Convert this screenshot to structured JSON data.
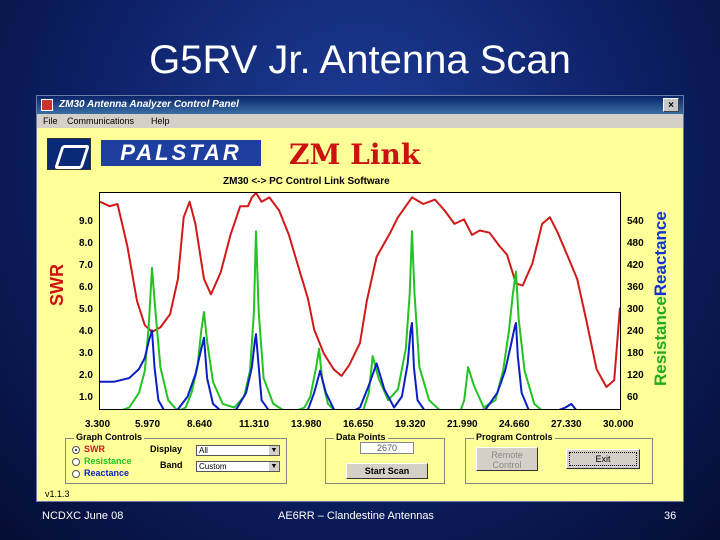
{
  "slide": {
    "title": "G5RV Jr. Antenna Scan",
    "footer_left": "NCDXC June 08",
    "footer_center": "AE6RR – Clandestine Antennas",
    "footer_right": "36"
  },
  "window": {
    "title": "ZM30 Antenna Analyzer Control Panel",
    "close_label": "×",
    "menu": [
      "File",
      "Communications",
      "Help"
    ]
  },
  "brand": {
    "palstar": "PALSTAR",
    "zmlink": "ZM Link",
    "subtitle": "ZM30 <-> PC Control Link Software"
  },
  "chart_data": {
    "type": "line",
    "x_ticks": [
      "3.300",
      "5.970",
      "8.640",
      "11.310",
      "13.980",
      "16.650",
      "19.320",
      "21.990",
      "24.660",
      "27.330",
      "30.000"
    ],
    "xlim": [
      3.3,
      30.0
    ],
    "left_axis_label": "SWR",
    "left_ticks": [
      "1.0",
      "2.0",
      "3.0",
      "4.0",
      "5.0",
      "6.0",
      "7.0",
      "8.0",
      "9.0"
    ],
    "ylim_left": [
      0.6,
      10.4
    ],
    "right_axis_label_1": "Resistance",
    "right_axis_label_2": "Reactance",
    "right_ticks": [
      "60",
      "120",
      "180",
      "240",
      "300",
      "360",
      "420",
      "480",
      "540"
    ],
    "series": [
      {
        "name": "SWR",
        "color": "#d11919",
        "axis": "left",
        "x": [
          3.3,
          3.8,
          4.2,
          4.7,
          5.2,
          5.6,
          5.97,
          6.4,
          6.9,
          7.3,
          7.6,
          7.9,
          8.2,
          8.64,
          9.0,
          9.5,
          10.0,
          10.5,
          10.9,
          11.1,
          11.31,
          11.6,
          12.0,
          12.5,
          13.0,
          13.5,
          13.98,
          14.3,
          14.8,
          15.3,
          15.7,
          16.1,
          16.65,
          17.0,
          17.5,
          18.2,
          18.6,
          19.0,
          19.32,
          19.9,
          20.5,
          21.0,
          21.5,
          21.99,
          22.4,
          22.8,
          23.3,
          23.8,
          24.2,
          24.66,
          25.0,
          25.5,
          26.0,
          26.4,
          26.8,
          27.33,
          27.8,
          28.3,
          28.8,
          29.3,
          29.7,
          30.0
        ],
        "y": [
          10.0,
          9.8,
          9.9,
          8.0,
          5.5,
          4.4,
          4.1,
          4.3,
          4.9,
          6.5,
          9.3,
          10.0,
          9.0,
          6.5,
          5.8,
          6.8,
          8.5,
          9.8,
          9.8,
          10.2,
          10.4,
          10.0,
          10.2,
          9.6,
          8.5,
          7.0,
          5.6,
          4.2,
          3.1,
          2.4,
          2.1,
          2.6,
          3.6,
          5.5,
          7.5,
          8.6,
          9.3,
          9.8,
          10.2,
          9.9,
          10.1,
          9.6,
          9.0,
          9.2,
          8.5,
          8.7,
          8.6,
          8.0,
          7.6,
          6.3,
          6.2,
          7.2,
          9.0,
          9.3,
          8.6,
          7.5,
          6.5,
          4.5,
          2.4,
          1.6,
          1.9,
          5.2
        ]
      },
      {
        "name": "Resistance",
        "color": "#22c322",
        "axis": "right",
        "x": [
          3.3,
          4.0,
          4.8,
          5.3,
          5.6,
          5.8,
          5.97,
          6.15,
          6.4,
          6.8,
          7.3,
          7.7,
          8.0,
          8.3,
          8.5,
          8.64,
          8.8,
          9.1,
          9.6,
          10.2,
          10.7,
          11.0,
          11.2,
          11.31,
          11.45,
          11.7,
          12.2,
          12.8,
          13.3,
          13.8,
          14.1,
          14.4,
          14.55,
          14.7,
          15.0,
          15.5,
          16.0,
          16.5,
          16.8,
          17.1,
          17.3,
          17.6,
          18.1,
          18.6,
          19.0,
          19.2,
          19.32,
          19.45,
          19.7,
          20.2,
          20.8,
          21.4,
          21.8,
          22.0,
          22.2,
          22.5,
          23.0,
          23.6,
          24.0,
          24.3,
          24.5,
          24.66,
          24.8,
          25.1,
          25.6,
          26.2,
          26.8,
          27.3,
          27.7,
          28.2,
          28.8,
          29.4,
          30.0
        ],
        "y": [
          20,
          25,
          40,
          80,
          140,
          260,
          420,
          300,
          150,
          60,
          30,
          40,
          80,
          150,
          250,
          300,
          220,
          110,
          50,
          40,
          70,
          140,
          300,
          520,
          300,
          120,
          50,
          30,
          30,
          40,
          70,
          150,
          200,
          120,
          50,
          25,
          15,
          15,
          30,
          80,
          180,
          120,
          60,
          90,
          200,
          350,
          520,
          350,
          150,
          60,
          30,
          20,
          30,
          60,
          150,
          100,
          40,
          60,
          140,
          250,
          350,
          410,
          280,
          140,
          50,
          20,
          15,
          25,
          15,
          15,
          20,
          15,
          15
        ]
      },
      {
        "name": "Reactance",
        "color": "#0a1fc2",
        "axis": "right",
        "x": [
          3.3,
          4.0,
          4.8,
          5.3,
          5.6,
          5.8,
          5.97,
          6.1,
          6.3,
          6.7,
          7.3,
          7.8,
          8.2,
          8.5,
          8.64,
          8.8,
          9.1,
          9.7,
          10.3,
          10.8,
          11.1,
          11.25,
          11.31,
          11.4,
          11.6,
          12.1,
          12.8,
          13.4,
          13.98,
          14.3,
          14.6,
          14.9,
          15.4,
          16.0,
          16.65,
          17.1,
          17.5,
          17.9,
          18.4,
          18.8,
          19.1,
          19.25,
          19.32,
          19.42,
          19.6,
          20.1,
          20.7,
          21.3,
          21.99,
          22.5,
          23.1,
          23.7,
          24.1,
          24.4,
          24.6,
          24.66,
          24.75,
          24.95,
          25.4,
          26.0,
          26.7,
          27.2,
          27.5,
          27.8,
          28.3,
          28.9,
          29.5,
          30.0
        ],
        "y": [
          110,
          110,
          120,
          145,
          175,
          220,
          250,
          150,
          60,
          20,
          35,
          70,
          130,
          200,
          230,
          120,
          50,
          20,
          35,
          80,
          150,
          220,
          240,
          180,
          60,
          20,
          20,
          20,
          35,
          80,
          140,
          80,
          25,
          20,
          40,
          100,
          160,
          90,
          40,
          70,
          160,
          250,
          270,
          150,
          60,
          20,
          20,
          30,
          30,
          30,
          35,
          80,
          140,
          210,
          260,
          270,
          180,
          80,
          20,
          25,
          30,
          40,
          50,
          30,
          25,
          20,
          20,
          20
        ]
      }
    ]
  },
  "graph_controls": {
    "title": "Graph Controls",
    "options": [
      "SWR",
      "Resistance",
      "Reactance"
    ],
    "display_label": "Display",
    "display_value": "All",
    "band_label": "Band",
    "band_value": "Custom"
  },
  "data_points": {
    "title": "Data Points",
    "value": "2670",
    "start_scan_label": "Start Scan"
  },
  "program_controls": {
    "title": "Program Controls",
    "remote_line1": "Remote",
    "remote_line2": "Control",
    "exit_label": "Exit"
  },
  "version": "v1.1.3",
  "colors": {
    "swr": "#d11919",
    "resistance": "#22c322",
    "reactance": "#0a1fc2",
    "panel": "#ffff99"
  }
}
